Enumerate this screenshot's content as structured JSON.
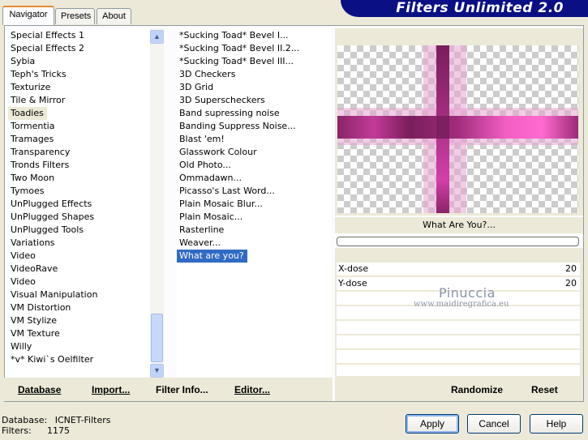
{
  "tabs": [
    {
      "label": "Navigator",
      "active": true
    },
    {
      "label": "Presets",
      "active": false
    },
    {
      "label": "About",
      "active": false
    }
  ],
  "banner": {
    "title": "Filters Unlimited 2.0"
  },
  "categories": [
    "Special Effects 1",
    "Special Effects 2",
    "Sybia",
    "Teph's Tricks",
    "Texturize",
    "Tile & Mirror",
    "Toadies",
    "Tormentia",
    "Tramages",
    "Transparency",
    "Tronds Filters",
    "Two Moon",
    "Tymoes",
    "UnPlugged Effects",
    "UnPlugged Shapes",
    "UnPlugged Tools",
    "Variations",
    "Video",
    "VideoRave",
    "Video",
    "Visual Manipulation",
    "VM Distortion",
    "VM Stylize",
    "VM Texture",
    "Willy",
    "*v* Kiwi`s Oelfilter"
  ],
  "selected_category": "Toadies",
  "filters": [
    "*Sucking Toad*  Bevel I...",
    "*Sucking Toad*  Bevel II.2...",
    "*Sucking Toad*  Bevel III...",
    "3D Checkers",
    "3D Grid",
    "3D Superscheckers",
    "Band supressing noise",
    "Banding Suppress Noise...",
    "Blast 'em!",
    "Glasswork Colour",
    "Old Photo...",
    "Ommadawn...",
    "Picasso's Last Word...",
    "Plain Mosaic Blur...",
    "Plain Mosaic...",
    "Rasterline",
    "Weaver...",
    "What are you?"
  ],
  "selected_filter": "What are you?",
  "left_buttons": {
    "database": "Database",
    "import": "Import...",
    "filter_info": "Filter Info...",
    "editor": "Editor..."
  },
  "right_buttons": {
    "randomize": "Randomize",
    "reset": "Reset"
  },
  "preview": {
    "filter_title": "What Are You?..."
  },
  "params": [
    {
      "label": "X-dose",
      "value": "20"
    },
    {
      "label": "Y-dose",
      "value": "20"
    }
  ],
  "watermark": {
    "name": "Pinuccia",
    "site": "www.maidiregrafica.eu"
  },
  "status": {
    "database_label": "Database:",
    "database_value": "ICNET-Filters",
    "filters_label": "Filters:",
    "filters_value": "1175"
  },
  "dialog_buttons": {
    "apply": "Apply",
    "cancel": "Cancel",
    "help": "Help"
  },
  "colors": {
    "banner": "#0b0f84",
    "selection": "#316ac5",
    "preview_pink": "#e040b0"
  }
}
